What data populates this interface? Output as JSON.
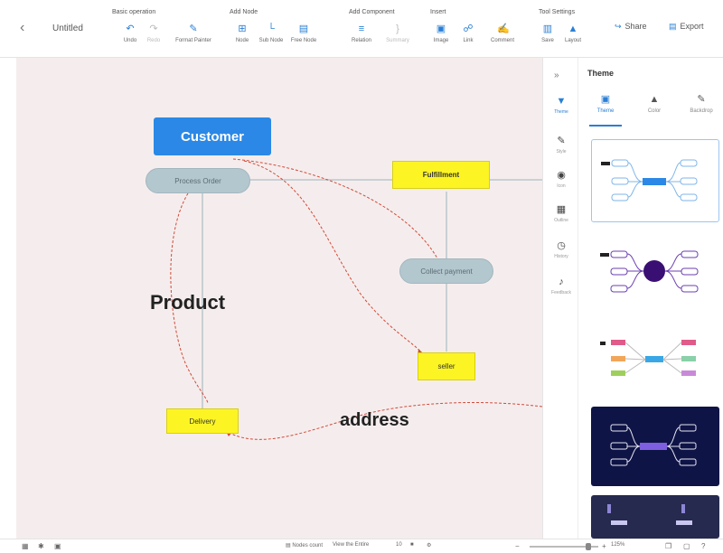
{
  "toolbar": {
    "doc_title": "Untitled",
    "groups": [
      {
        "label": "Basic operation",
        "tools": [
          {
            "label": "Undo",
            "icon": "undo-icon"
          },
          {
            "label": "Redo",
            "icon": "redo-icon"
          },
          {
            "label": "Format Painter",
            "icon": "format-painter-icon"
          }
        ]
      },
      {
        "label": "Add Node",
        "tools": [
          {
            "label": "Node",
            "icon": "add-node-icon"
          },
          {
            "label": "Sub Node",
            "icon": "add-subnode-icon"
          },
          {
            "label": "Free Node",
            "icon": "free-node-icon"
          }
        ]
      },
      {
        "label": "Add Component",
        "tools": [
          {
            "label": "Relation",
            "icon": "relation-icon"
          },
          {
            "label": "Summary",
            "icon": "summary-icon"
          }
        ]
      },
      {
        "label": "Insert",
        "tools": [
          {
            "label": "Image",
            "icon": "image-icon"
          },
          {
            "label": "Link",
            "icon": "link-icon"
          },
          {
            "label": "Comment",
            "icon": "comment-icon"
          }
        ]
      },
      {
        "label": "Tool Settings",
        "tools": [
          {
            "label": "Save",
            "icon": "save-icon"
          },
          {
            "label": "Layout",
            "icon": "layout-icon"
          }
        ]
      }
    ],
    "share_label": "Share",
    "export_label": "Export"
  },
  "canvas": {
    "background": "#f5eded",
    "nodes": {
      "customer": "Customer",
      "process_order": "Process Order",
      "fulfillment": "Fulfillment",
      "collect_payment": "Collect payment",
      "seller": "seller",
      "delivery": "Delivery"
    },
    "free_text": {
      "product": "Product",
      "address": "address"
    }
  },
  "rail": {
    "items": [
      {
        "label": "Theme",
        "icon": "theme-icon",
        "active": true
      },
      {
        "label": "Style",
        "icon": "style-icon",
        "active": false
      },
      {
        "label": "Icon",
        "icon": "icon-library-icon",
        "active": false
      },
      {
        "label": "Outline",
        "icon": "outline-icon",
        "active": false
      },
      {
        "label": "History",
        "icon": "history-icon",
        "active": false
      },
      {
        "label": "Feedback",
        "icon": "feedback-icon",
        "active": false
      }
    ]
  },
  "panel": {
    "title": "Theme",
    "tabs": [
      {
        "label": "Theme",
        "icon": "theme-icon",
        "active": true
      },
      {
        "label": "Color",
        "icon": "color-icon",
        "active": false
      },
      {
        "label": "Backdrop",
        "icon": "backdrop-icon",
        "active": false
      }
    ]
  },
  "statusbar": {
    "node_count": "Nodes count",
    "view_mode": "View the Entire",
    "zoom": "125%",
    "page": "10"
  },
  "colors": {
    "accent": "#2b88e6",
    "yellow_node": "#fdf523",
    "pill_node": "#b3c7cf",
    "relation_line": "#d14a3a"
  }
}
